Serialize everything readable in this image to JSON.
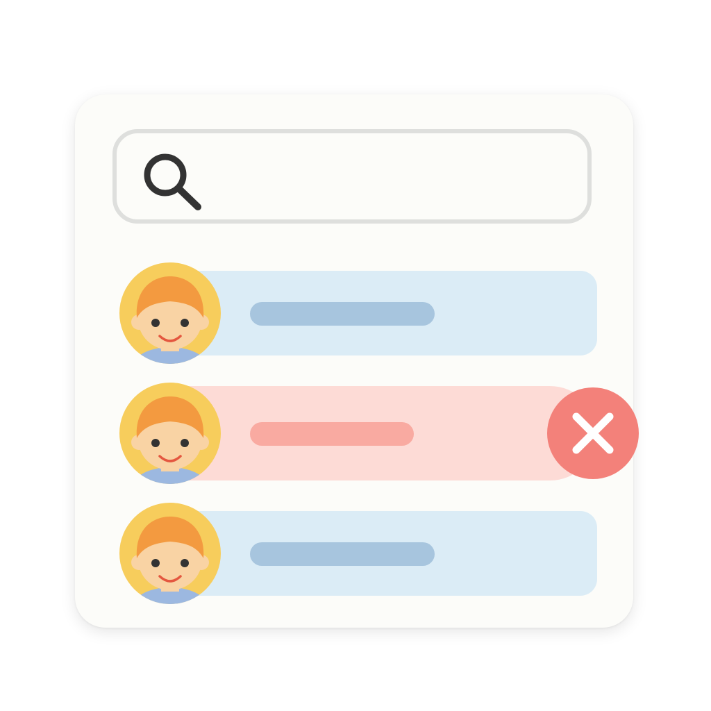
{
  "search": {
    "value": "",
    "placeholder": "",
    "icon": "search-icon"
  },
  "contacts": [
    {
      "state": "normal",
      "label": "",
      "avatar": "avatar-icon"
    },
    {
      "state": "deleting",
      "label": "",
      "avatar": "avatar-icon",
      "action_icon": "close-icon"
    },
    {
      "state": "normal",
      "label": "",
      "avatar": "avatar-icon"
    }
  ],
  "colors": {
    "card_background": "#fcfcf9",
    "row_normal": "#dbecf6",
    "row_normal_line": "#a7c5de",
    "row_deleting": "#fddbd6",
    "row_deleting_line": "#f9aaa1",
    "delete_button": "#f3817a",
    "avatar_ring": "#f7cd5c",
    "avatar_hair": "#f39a40"
  }
}
